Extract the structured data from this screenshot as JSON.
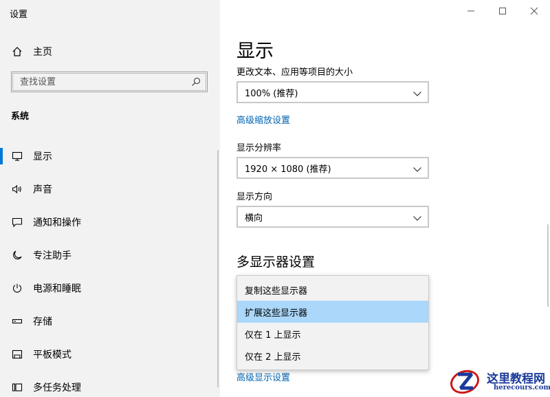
{
  "window": {
    "title": "设置",
    "controls": [
      "minimize",
      "maximize",
      "close"
    ]
  },
  "sidebar": {
    "home": {
      "label": "主页",
      "icon": "home-icon"
    },
    "search": {
      "placeholder": "查找设置",
      "icon": "search-icon"
    },
    "section": "系统",
    "items": [
      {
        "label": "显示",
        "icon": "monitor-icon",
        "active": true
      },
      {
        "label": "声音",
        "icon": "speaker-icon",
        "active": false
      },
      {
        "label": "通知和操作",
        "icon": "notification-icon",
        "active": false
      },
      {
        "label": "专注助手",
        "icon": "moon-icon",
        "active": false
      },
      {
        "label": "电源和睡眠",
        "icon": "power-icon",
        "active": false
      },
      {
        "label": "存储",
        "icon": "storage-icon",
        "active": false
      },
      {
        "label": "平板模式",
        "icon": "tablet-icon",
        "active": false
      },
      {
        "label": "多任务处理",
        "icon": "multitask-icon",
        "active": false
      }
    ]
  },
  "main": {
    "title": "显示",
    "scale": {
      "label": "更改文本、应用等项目的大小",
      "value": "100% (推荐)"
    },
    "advanced_scaling_link": "高级缩放设置",
    "resolution": {
      "label": "显示分辨率",
      "value": "1920 × 1080 (推荐)"
    },
    "orientation": {
      "label": "显示方向",
      "value": "横向"
    },
    "multi_display": {
      "title": "多显示器设置",
      "options": [
        {
          "label": "复制这些显示器",
          "selected": false
        },
        {
          "label": "扩展这些显示器",
          "selected": true
        },
        {
          "label": "仅在 1 上显示",
          "selected": false
        },
        {
          "label": "仅在 2 上显示",
          "selected": false
        }
      ]
    },
    "advanced_display_link": "高级显示设置"
  },
  "watermark": {
    "text_cn": "这里教程网",
    "text_en": "herecours.com"
  },
  "colors": {
    "accent": "#0078d7",
    "link": "#0063b1",
    "selection": "#aad7fa",
    "sidebar_bg": "#f2f2f2"
  }
}
